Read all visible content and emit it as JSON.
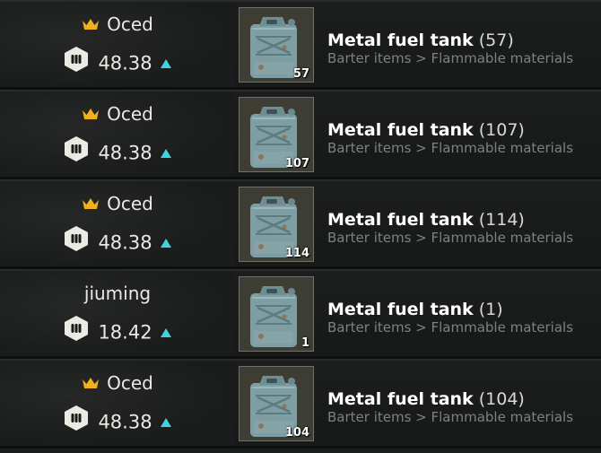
{
  "colors": {
    "accent_arrow": "#3fd3e0",
    "crown": "#f2b01e",
    "text": "#e9e9e4",
    "muted": "#7d8184"
  },
  "offers": [
    {
      "seller": "Oced",
      "crown": true,
      "price": "48.38",
      "item_name": "Metal fuel tank",
      "qty_text": "(57)",
      "category": "Barter items > Flammable materials",
      "stack_count": "57",
      "icon": "fuel-tank-icon"
    },
    {
      "seller": "Oced",
      "crown": true,
      "price": "48.38",
      "item_name": "Metal fuel tank",
      "qty_text": "(107)",
      "category": "Barter items > Flammable materials",
      "stack_count": "107",
      "icon": "fuel-tank-icon"
    },
    {
      "seller": "Oced",
      "crown": true,
      "price": "48.38",
      "item_name": "Metal fuel tank",
      "qty_text": "(114)",
      "category": "Barter items > Flammable materials",
      "stack_count": "114",
      "icon": "fuel-tank-icon"
    },
    {
      "seller": "jiuming",
      "crown": false,
      "price": "18.42",
      "item_name": "Metal fuel tank",
      "qty_text": "(1)",
      "category": "Barter items > Flammable materials",
      "stack_count": "1",
      "icon": "fuel-tank-icon"
    },
    {
      "seller": "Oced",
      "crown": true,
      "price": "48.38",
      "item_name": "Metal fuel tank",
      "qty_text": "(104)",
      "category": "Barter items > Flammable materials",
      "stack_count": "104",
      "icon": "fuel-tank-icon"
    }
  ]
}
